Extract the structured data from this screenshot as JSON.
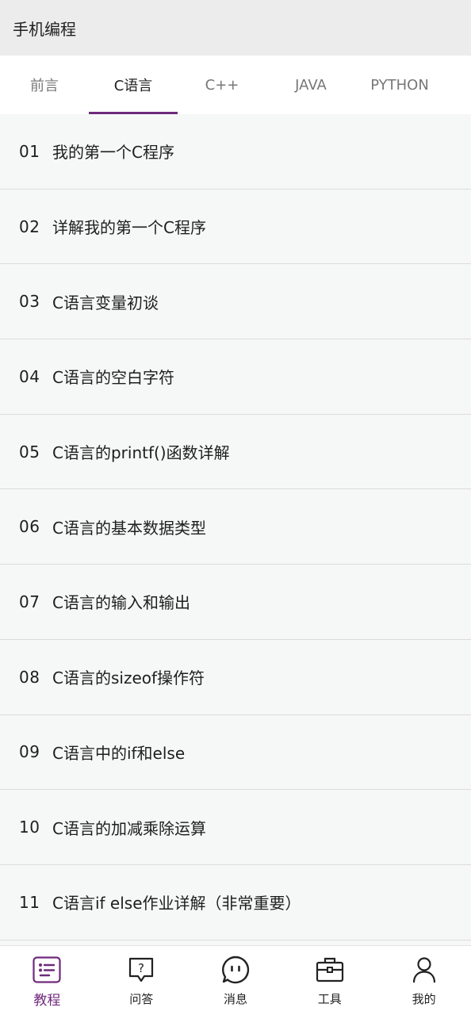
{
  "app": {
    "title": "手机编程"
  },
  "tabs": [
    {
      "label": "前言"
    },
    {
      "label": "C语言"
    },
    {
      "label": "C++"
    },
    {
      "label": "JAVA"
    },
    {
      "label": "PYTHON"
    }
  ],
  "active_tab_index": 1,
  "lessons": [
    {
      "num": "01",
      "title": "我的第一个C程序"
    },
    {
      "num": "02",
      "title": "详解我的第一个C程序"
    },
    {
      "num": "03",
      "title": "C语言变量初谈"
    },
    {
      "num": "04",
      "title": "C语言的空白字符"
    },
    {
      "num": "05",
      "title": "C语言的printf()函数详解"
    },
    {
      "num": "06",
      "title": "C语言的基本数据类型"
    },
    {
      "num": "07",
      "title": "C语言的输入和输出"
    },
    {
      "num": "08",
      "title": "C语言的sizeof操作符"
    },
    {
      "num": "09",
      "title": "C语言中的if和else"
    },
    {
      "num": "10",
      "title": "C语言的加减乘除运算"
    },
    {
      "num": "11",
      "title": "C语言if else作业详解（非常重要）"
    }
  ],
  "bottom_nav": [
    {
      "label": "教程",
      "icon": "list-icon"
    },
    {
      "label": "问答",
      "icon": "question-bubble-icon"
    },
    {
      "label": "消息",
      "icon": "chat-bubble-icon"
    },
    {
      "label": "工具",
      "icon": "toolbox-icon"
    },
    {
      "label": "我的",
      "icon": "person-icon"
    }
  ],
  "colors": {
    "accent": "#6f2a7c",
    "appbar_bg": "#ececec",
    "list_bg": "#f6f7f7"
  }
}
